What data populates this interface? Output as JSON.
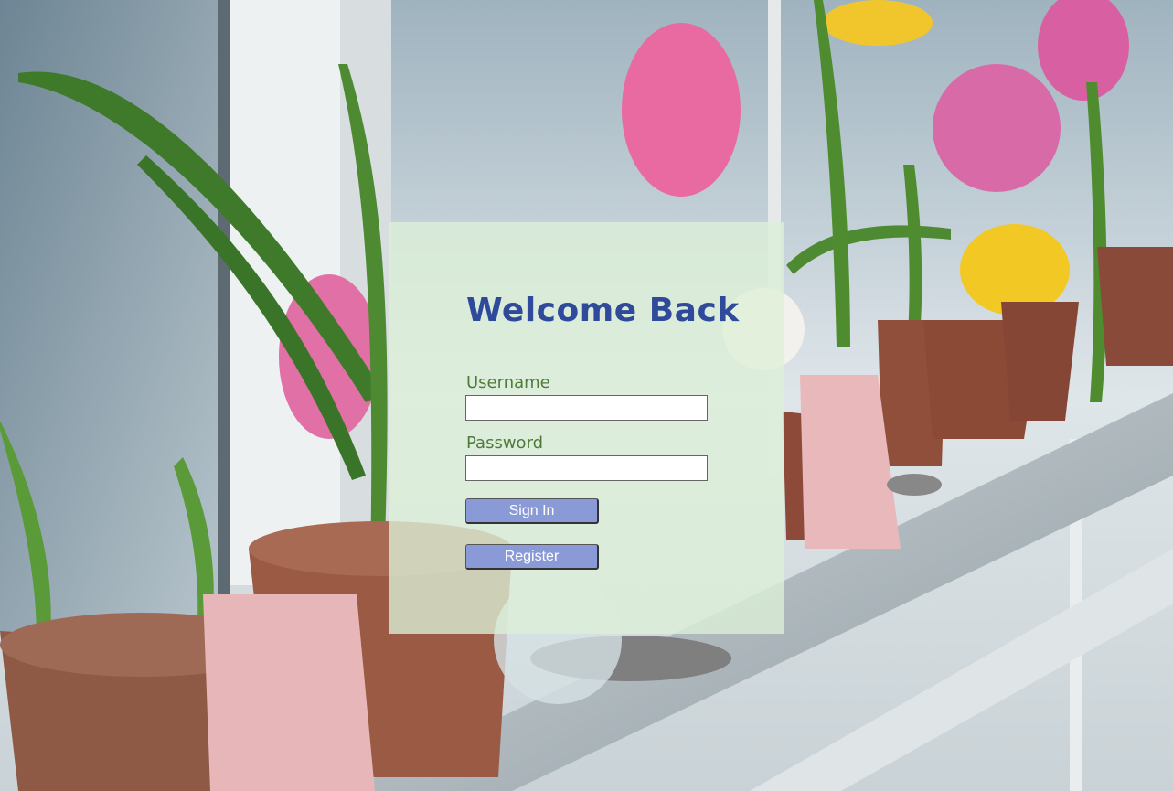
{
  "login": {
    "title": "Welcome Back",
    "username_label": "Username",
    "username_value": "",
    "password_label": "Password",
    "password_value": "",
    "sign_in_label": "Sign In",
    "register_label": "Register"
  },
  "colors": {
    "title": "#2f4a9a",
    "label": "#4f7a3a",
    "button_bg": "#8a9ad6",
    "panel_bg": "rgba(220,240,215,0.78)"
  },
  "background": {
    "description_icon": "flower-pots-window-photo"
  }
}
